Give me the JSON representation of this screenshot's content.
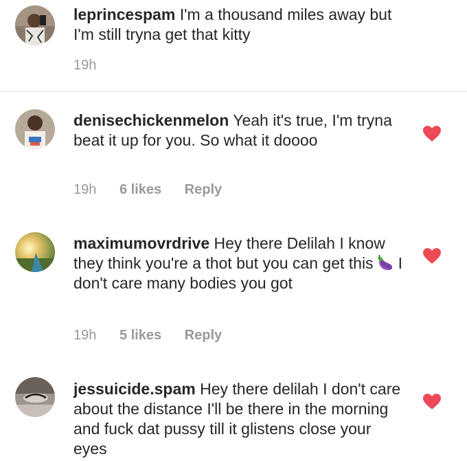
{
  "comments": [
    {
      "username": "leprincespam",
      "text": "I'm a thousand miles away but I'm still tryna get that kitty",
      "time": "19h"
    },
    {
      "username": "denisechickenmelon",
      "text": "Yeah it's true, I'm tryna beat it up for you. So what it doooo",
      "time": "19h",
      "likes": "6 likes",
      "reply": "Reply",
      "liked": true
    },
    {
      "username": "maximumovrdrive",
      "text_before": "Hey there Delilah I know they think you're a thot but you can get this",
      "emoji": "eggplant-emoji",
      "text_after": "I don't care many bodies you got",
      "time": "19h",
      "likes": "5 likes",
      "reply": "Reply",
      "liked": true
    },
    {
      "username": "jessuicide.spam",
      "text": "Hey there delilah I don't care about the distance I'll be there in the morning and fuck dat pussy till it glistens close your eyes",
      "liked": true
    }
  ],
  "colors": {
    "heart": "#ed4956",
    "meta": "#999999",
    "text": "#262626",
    "divider": "#dbdbdb"
  }
}
